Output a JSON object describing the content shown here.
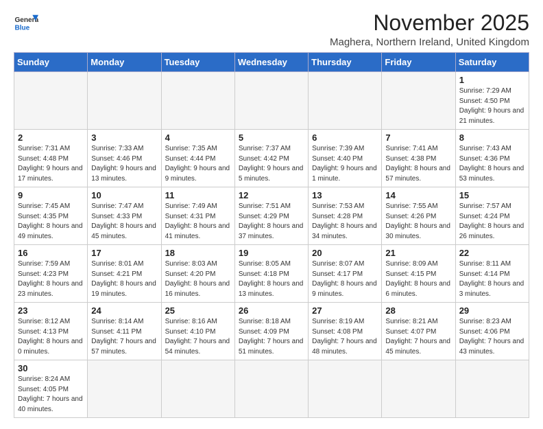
{
  "header": {
    "logo_general": "General",
    "logo_blue": "Blue",
    "month_title": "November 2025",
    "subtitle": "Maghera, Northern Ireland, United Kingdom"
  },
  "days_of_week": [
    "Sunday",
    "Monday",
    "Tuesday",
    "Wednesday",
    "Thursday",
    "Friday",
    "Saturday"
  ],
  "weeks": [
    [
      {
        "day": "",
        "info": ""
      },
      {
        "day": "",
        "info": ""
      },
      {
        "day": "",
        "info": ""
      },
      {
        "day": "",
        "info": ""
      },
      {
        "day": "",
        "info": ""
      },
      {
        "day": "",
        "info": ""
      },
      {
        "day": "1",
        "info": "Sunrise: 7:29 AM\nSunset: 4:50 PM\nDaylight: 9 hours\nand 21 minutes."
      }
    ],
    [
      {
        "day": "2",
        "info": "Sunrise: 7:31 AM\nSunset: 4:48 PM\nDaylight: 9 hours\nand 17 minutes."
      },
      {
        "day": "3",
        "info": "Sunrise: 7:33 AM\nSunset: 4:46 PM\nDaylight: 9 hours\nand 13 minutes."
      },
      {
        "day": "4",
        "info": "Sunrise: 7:35 AM\nSunset: 4:44 PM\nDaylight: 9 hours\nand 9 minutes."
      },
      {
        "day": "5",
        "info": "Sunrise: 7:37 AM\nSunset: 4:42 PM\nDaylight: 9 hours\nand 5 minutes."
      },
      {
        "day": "6",
        "info": "Sunrise: 7:39 AM\nSunset: 4:40 PM\nDaylight: 9 hours\nand 1 minute."
      },
      {
        "day": "7",
        "info": "Sunrise: 7:41 AM\nSunset: 4:38 PM\nDaylight: 8 hours\nand 57 minutes."
      },
      {
        "day": "8",
        "info": "Sunrise: 7:43 AM\nSunset: 4:36 PM\nDaylight: 8 hours\nand 53 minutes."
      }
    ],
    [
      {
        "day": "9",
        "info": "Sunrise: 7:45 AM\nSunset: 4:35 PM\nDaylight: 8 hours\nand 49 minutes."
      },
      {
        "day": "10",
        "info": "Sunrise: 7:47 AM\nSunset: 4:33 PM\nDaylight: 8 hours\nand 45 minutes."
      },
      {
        "day": "11",
        "info": "Sunrise: 7:49 AM\nSunset: 4:31 PM\nDaylight: 8 hours\nand 41 minutes."
      },
      {
        "day": "12",
        "info": "Sunrise: 7:51 AM\nSunset: 4:29 PM\nDaylight: 8 hours\nand 37 minutes."
      },
      {
        "day": "13",
        "info": "Sunrise: 7:53 AM\nSunset: 4:28 PM\nDaylight: 8 hours\nand 34 minutes."
      },
      {
        "day": "14",
        "info": "Sunrise: 7:55 AM\nSunset: 4:26 PM\nDaylight: 8 hours\nand 30 minutes."
      },
      {
        "day": "15",
        "info": "Sunrise: 7:57 AM\nSunset: 4:24 PM\nDaylight: 8 hours\nand 26 minutes."
      }
    ],
    [
      {
        "day": "16",
        "info": "Sunrise: 7:59 AM\nSunset: 4:23 PM\nDaylight: 8 hours\nand 23 minutes."
      },
      {
        "day": "17",
        "info": "Sunrise: 8:01 AM\nSunset: 4:21 PM\nDaylight: 8 hours\nand 19 minutes."
      },
      {
        "day": "18",
        "info": "Sunrise: 8:03 AM\nSunset: 4:20 PM\nDaylight: 8 hours\nand 16 minutes."
      },
      {
        "day": "19",
        "info": "Sunrise: 8:05 AM\nSunset: 4:18 PM\nDaylight: 8 hours\nand 13 minutes."
      },
      {
        "day": "20",
        "info": "Sunrise: 8:07 AM\nSunset: 4:17 PM\nDaylight: 8 hours\nand 9 minutes."
      },
      {
        "day": "21",
        "info": "Sunrise: 8:09 AM\nSunset: 4:15 PM\nDaylight: 8 hours\nand 6 minutes."
      },
      {
        "day": "22",
        "info": "Sunrise: 8:11 AM\nSunset: 4:14 PM\nDaylight: 8 hours\nand 3 minutes."
      }
    ],
    [
      {
        "day": "23",
        "info": "Sunrise: 8:12 AM\nSunset: 4:13 PM\nDaylight: 8 hours\nand 0 minutes."
      },
      {
        "day": "24",
        "info": "Sunrise: 8:14 AM\nSunset: 4:11 PM\nDaylight: 7 hours\nand 57 minutes."
      },
      {
        "day": "25",
        "info": "Sunrise: 8:16 AM\nSunset: 4:10 PM\nDaylight: 7 hours\nand 54 minutes."
      },
      {
        "day": "26",
        "info": "Sunrise: 8:18 AM\nSunset: 4:09 PM\nDaylight: 7 hours\nand 51 minutes."
      },
      {
        "day": "27",
        "info": "Sunrise: 8:19 AM\nSunset: 4:08 PM\nDaylight: 7 hours\nand 48 minutes."
      },
      {
        "day": "28",
        "info": "Sunrise: 8:21 AM\nSunset: 4:07 PM\nDaylight: 7 hours\nand 45 minutes."
      },
      {
        "day": "29",
        "info": "Sunrise: 8:23 AM\nSunset: 4:06 PM\nDaylight: 7 hours\nand 43 minutes."
      }
    ],
    [
      {
        "day": "30",
        "info": "Sunrise: 8:24 AM\nSunset: 4:05 PM\nDaylight: 7 hours\nand 40 minutes."
      },
      {
        "day": "",
        "info": ""
      },
      {
        "day": "",
        "info": ""
      },
      {
        "day": "",
        "info": ""
      },
      {
        "day": "",
        "info": ""
      },
      {
        "day": "",
        "info": ""
      },
      {
        "day": "",
        "info": ""
      }
    ]
  ]
}
